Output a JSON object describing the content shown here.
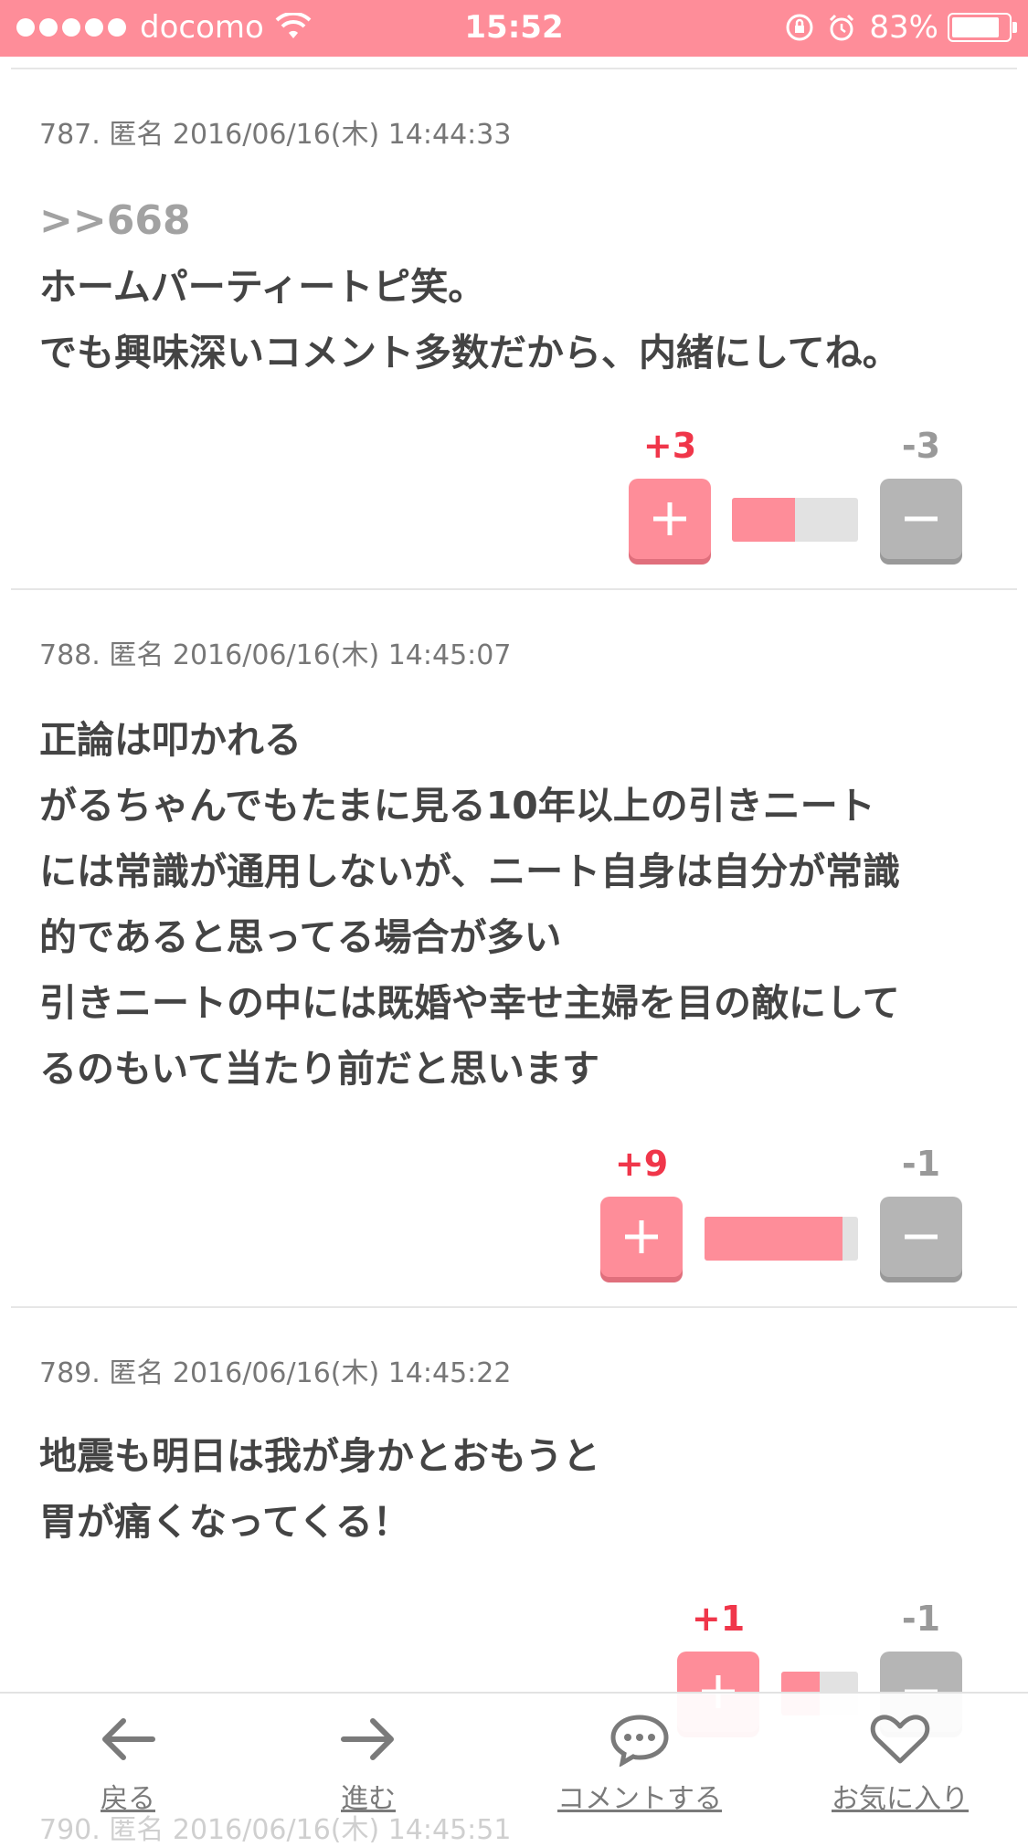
{
  "status_bar": {
    "carrier": "docomo",
    "time": "15:52",
    "battery": "83%",
    "battery_level": 0.83
  },
  "comments": [
    {
      "meta": "787. 匿名 2016/06/16(木) 14:44:33",
      "anchor": ">>668",
      "lines": [
        "ホームパーティートピ笑。",
        "でも興味深いコメント多数だから、内緒にしてね。"
      ],
      "plus": "+3",
      "minus": "-3",
      "plus_ratio": 0.5
    },
    {
      "meta": "788. 匿名 2016/06/16(木) 14:45:07",
      "anchor": "",
      "lines": [
        "正論は叩かれる",
        "がるちゃんでもたまに見る10年以上の引きニート",
        "には常識が通用しないが、ニート自身は自分が常識",
        "的であると思ってる場合が多い",
        "引きニートの中には既婚や幸せ主婦を目の敵にして",
        "るのもいて当たり前だと思います"
      ],
      "plus": "+9",
      "minus": "-1",
      "plus_ratio": 0.9
    },
    {
      "meta": "789. 匿名 2016/06/16(木) 14:45:22",
      "anchor": "",
      "lines": [
        "地震も明日は我が身かとおもうと",
        "胃が痛くなってくる！"
      ],
      "plus": "+1",
      "minus": "-1",
      "plus_ratio": 0.5
    }
  ],
  "next_comment_peek": "790. 匿名 2016/06/16(木) 14:45:51",
  "bottom_nav": {
    "back": "戻る",
    "forward": "進む",
    "comment": "コメントする",
    "favorite": "お気に入り"
  },
  "colors": {
    "accent": "#fe8d99",
    "plus_text": "#f0364a",
    "minus_button": "#b5b5b5"
  },
  "icons": [
    "wifi-icon",
    "rotation-lock-icon",
    "alarm-icon",
    "battery-icon",
    "plus-icon",
    "minus-icon",
    "arrow-left-icon",
    "arrow-right-icon",
    "chat-bubble-icon",
    "heart-icon"
  ]
}
